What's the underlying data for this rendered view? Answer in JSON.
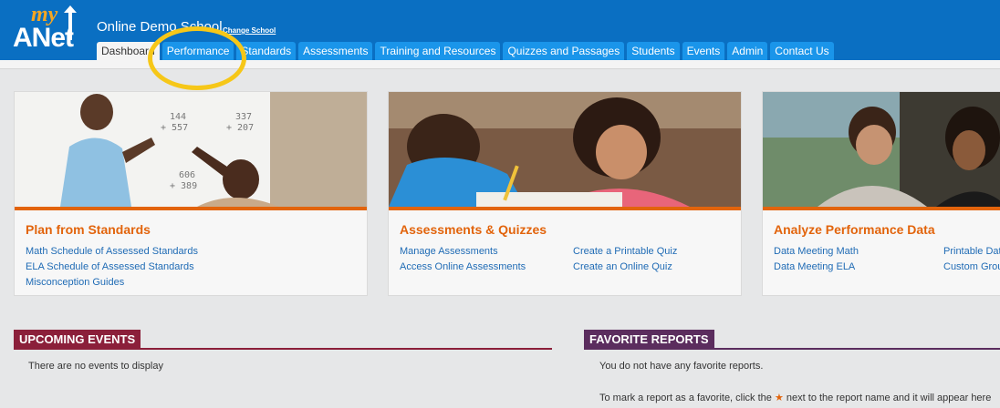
{
  "header": {
    "logo_top": "my",
    "logo_main": "ANet",
    "school_name": "Online Demo School",
    "change_school": "Change School"
  },
  "tabs": [
    {
      "label": "Dashboard",
      "active": true
    },
    {
      "label": "Performance"
    },
    {
      "label": "Standards"
    },
    {
      "label": "Assessments"
    },
    {
      "label": "Training and Resources"
    },
    {
      "label": "Quizzes and Passages"
    },
    {
      "label": "Students"
    },
    {
      "label": "Events"
    },
    {
      "label": "Admin"
    },
    {
      "label": "Contact Us"
    }
  ],
  "cards": [
    {
      "title": "Plan from Standards",
      "links_col1": [
        "Math Schedule of Assessed Standards",
        "ELA Schedule of Assessed Standards",
        "Misconception Guides"
      ],
      "links_col2": [],
      "whiteboard_numbers": [
        "144",
        "+ 557",
        "337",
        "+ 207",
        "606",
        "+ 389"
      ]
    },
    {
      "title": "Assessments & Quizzes",
      "links_col1": [
        "Manage Assessments",
        "Access Online Assessments"
      ],
      "links_col2": [
        "Create a Printable Quiz",
        "Create an Online Quiz"
      ]
    },
    {
      "title": "Analyze Performance Data",
      "links_col1": [
        "Data Meeting Math",
        "Data Meeting ELA"
      ],
      "links_col2": [
        "Printable Dat",
        "Custom Grou"
      ]
    }
  ],
  "events": {
    "title": "UPCOMING EVENTS",
    "empty_text": "There are no events to display"
  },
  "favorites": {
    "title": "FAVORITE REPORTS",
    "empty_text": "You do not have any favorite reports.",
    "hint_before": "To mark a report as a favorite, click the",
    "hint_star": "★",
    "hint_after": "next to the report name and it will appear here"
  },
  "colors": {
    "header_blue": "#0a6fc2",
    "tab_blue": "#1a95ea",
    "accent_orange": "#e2640c",
    "events_red": "#8b1f3a",
    "favorites_purple": "#5b2d5e",
    "highlight_yellow": "#f6c718"
  }
}
